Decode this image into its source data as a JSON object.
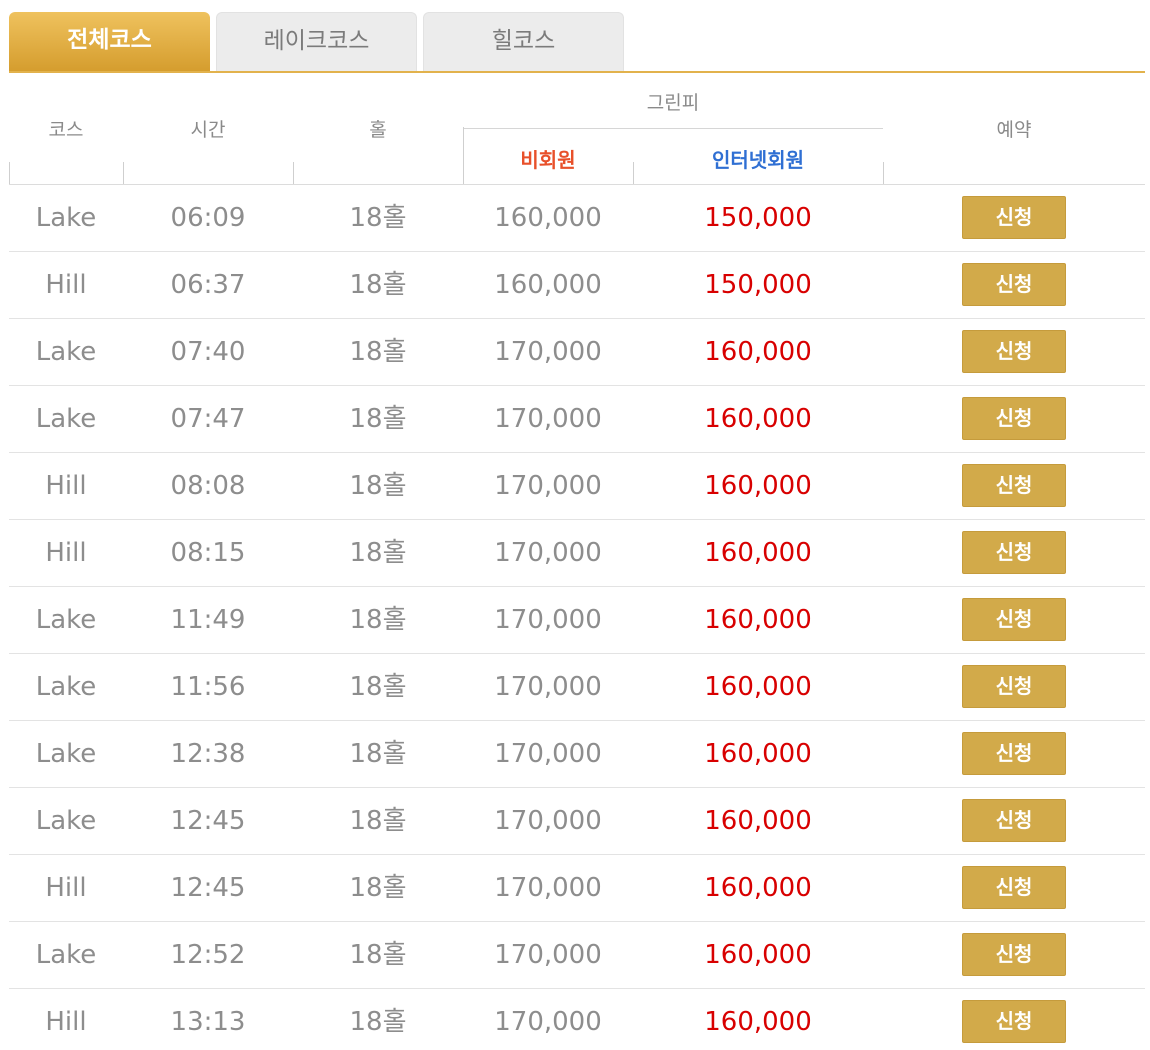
{
  "tabs": [
    {
      "label": "전체코스",
      "active": true
    },
    {
      "label": "레이크코스",
      "active": false
    },
    {
      "label": "힐코스",
      "active": false
    }
  ],
  "header": {
    "course": "코스",
    "time": "시간",
    "hole": "홀",
    "greenfee": "그린피",
    "non_member": "비회원",
    "internet_member": "인터넷회원",
    "reserve": "예약"
  },
  "colors": {
    "accent": "#d2aa4a",
    "non_member_label": "#e8502a",
    "internet_member_label": "#2f6fd3",
    "price_red": "#d80000"
  },
  "rows": [
    {
      "course": "Lake",
      "time": "06:09",
      "hole": "18홀",
      "non_member": "160,000",
      "internet": "150,000",
      "action": "신청"
    },
    {
      "course": "Hill",
      "time": "06:37",
      "hole": "18홀",
      "non_member": "160,000",
      "internet": "150,000",
      "action": "신청"
    },
    {
      "course": "Lake",
      "time": "07:40",
      "hole": "18홀",
      "non_member": "170,000",
      "internet": "160,000",
      "action": "신청"
    },
    {
      "course": "Lake",
      "time": "07:47",
      "hole": "18홀",
      "non_member": "170,000",
      "internet": "160,000",
      "action": "신청"
    },
    {
      "course": "Hill",
      "time": "08:08",
      "hole": "18홀",
      "non_member": "170,000",
      "internet": "160,000",
      "action": "신청"
    },
    {
      "course": "Hill",
      "time": "08:15",
      "hole": "18홀",
      "non_member": "170,000",
      "internet": "160,000",
      "action": "신청"
    },
    {
      "course": "Lake",
      "time": "11:49",
      "hole": "18홀",
      "non_member": "170,000",
      "internet": "160,000",
      "action": "신청"
    },
    {
      "course": "Lake",
      "time": "11:56",
      "hole": "18홀",
      "non_member": "170,000",
      "internet": "160,000",
      "action": "신청"
    },
    {
      "course": "Lake",
      "time": "12:38",
      "hole": "18홀",
      "non_member": "170,000",
      "internet": "160,000",
      "action": "신청"
    },
    {
      "course": "Lake",
      "time": "12:45",
      "hole": "18홀",
      "non_member": "170,000",
      "internet": "160,000",
      "action": "신청"
    },
    {
      "course": "Hill",
      "time": "12:45",
      "hole": "18홀",
      "non_member": "170,000",
      "internet": "160,000",
      "action": "신청"
    },
    {
      "course": "Lake",
      "time": "12:52",
      "hole": "18홀",
      "non_member": "170,000",
      "internet": "160,000",
      "action": "신청"
    },
    {
      "course": "Hill",
      "time": "13:13",
      "hole": "18홀",
      "non_member": "170,000",
      "internet": "160,000",
      "action": "신청"
    }
  ]
}
